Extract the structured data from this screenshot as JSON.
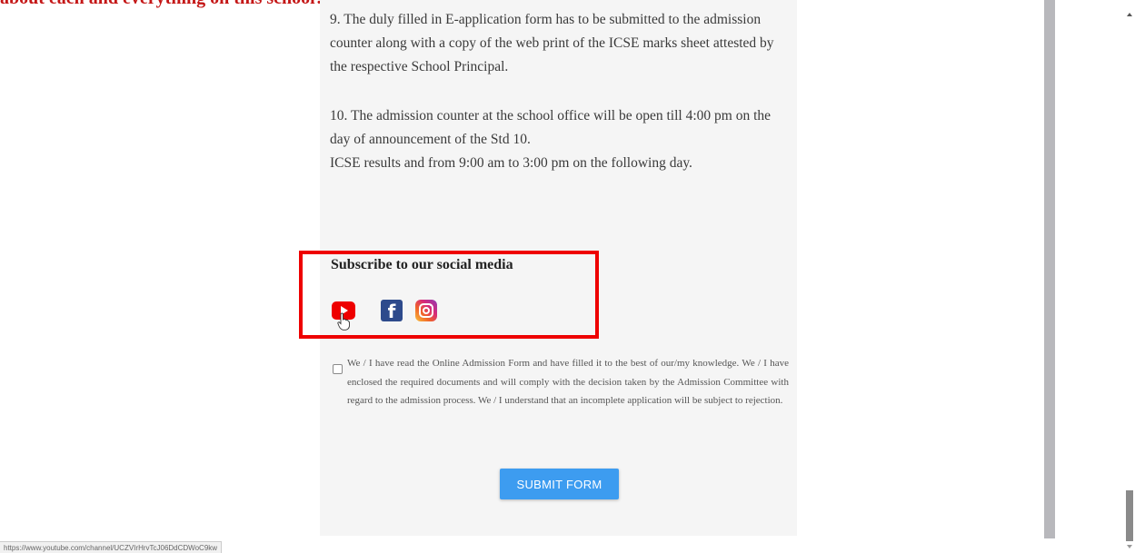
{
  "top_heading": "about each and everything on this school?",
  "instructions": {
    "item9": "9. The duly filled in E-application form has to be submitted to the admission counter along with a copy of the web print of the ICSE marks sheet attested by the respective School Principal.",
    "item10_line1": "10. The admission counter at the school office will be open till 4:00 pm on the day of announcement of the Std 10.",
    "item10_line2": "ICSE results and from 9:00 am to 3:00 pm on the following day."
  },
  "social": {
    "title": "Subscribe to our social media",
    "icons": [
      "youtube-icon",
      "facebook-icon",
      "instagram-icon"
    ],
    "facebook_glyph": "f",
    "highlight_color": "#ee0000"
  },
  "declaration": {
    "checked": false,
    "text": "We / I have read the Online Admission Form and have filled it to the best of our/my knowledge. We / I have enclosed the required documents and will comply with the decision taken by the Admission Committee with regard to the admission process. We / I understand that an incomplete application will be subject to rejection."
  },
  "submit": {
    "label": "SUBMIT FORM",
    "color": "#3d9cf0"
  },
  "status_bar": {
    "url": "https://www.youtube.com/channel/UCZVIrHrvTcJ06DdCDWoC9kw"
  }
}
